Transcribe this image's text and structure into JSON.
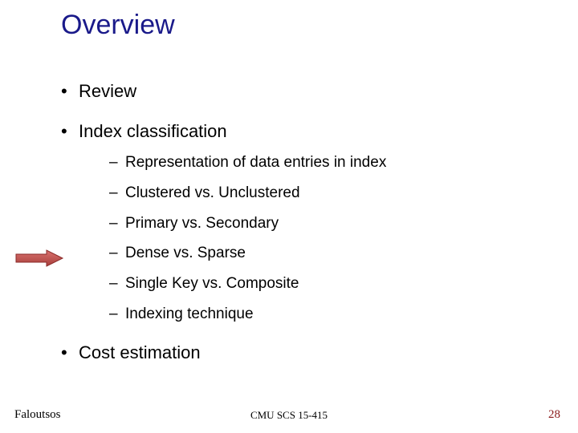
{
  "title": "Overview",
  "bullets": {
    "b1": "Review",
    "b2": "Index classification",
    "b2_sub": {
      "s1": "Representation of data entries in index",
      "s2": "Clustered vs. Unclustered",
      "s3": "Primary vs. Secondary",
      "s4": "Dense vs. Sparse",
      "s5": "Single Key vs. Composite",
      "s6": "Indexing technique"
    },
    "b3": "Cost estimation"
  },
  "footer": {
    "left": "Faloutsos",
    "center": "CMU SCS 15-415",
    "right": "28"
  },
  "colors": {
    "title": "#1a1a8a",
    "arrow_fill": "#c0504d",
    "arrow_stroke": "#8a2a28",
    "page_number": "#8a1a1a"
  }
}
